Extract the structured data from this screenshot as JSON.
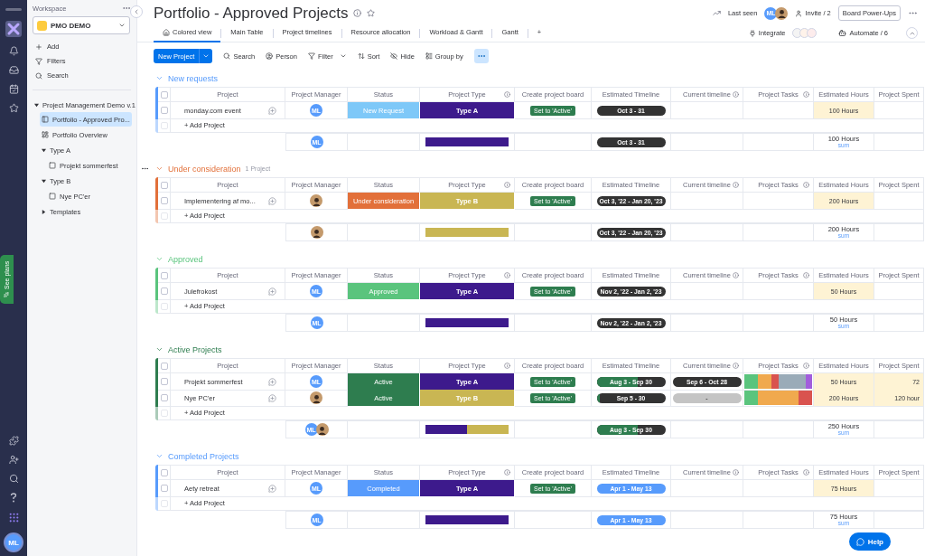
{
  "rail": {
    "see_plans": "See plans",
    "avatar": "ML"
  },
  "sidebar": {
    "workspace_label": "Workspace",
    "workspace": "PMO DEMO",
    "actions": [
      "Add",
      "Filters",
      "Search"
    ],
    "tree": [
      {
        "label": "Project Management Demo v.1",
        "kind": "folder",
        "expanded": true,
        "children": [
          {
            "label": "Portfolio - Approved Pro...",
            "kind": "board",
            "selected": true
          },
          {
            "label": "Portfolio Overview",
            "kind": "dashboard",
            "selected": false
          },
          {
            "label": "Type A",
            "kind": "folder",
            "expanded": true,
            "children": [
              {
                "label": "Projekt sommerfest",
                "kind": "board",
                "selected": false
              }
            ]
          },
          {
            "label": "Type B",
            "kind": "folder",
            "expanded": true,
            "children": [
              {
                "label": "Nye PC'er",
                "kind": "board",
                "selected": false
              }
            ]
          },
          {
            "label": "Templates",
            "kind": "folder",
            "expanded": false
          }
        ]
      }
    ]
  },
  "header": {
    "title": "Portfolio - Approved Projects",
    "last_seen": "Last seen",
    "last_seen_avatars": [
      {
        "kind": "initials",
        "initials": "ML"
      },
      {
        "kind": "photo"
      }
    ],
    "invite": "Invite / 2",
    "power_ups": "Board Power-Ups"
  },
  "tabs": [
    {
      "label": "Colored view",
      "selected": true
    },
    {
      "label": "Main Table",
      "selected": false
    },
    {
      "label": "Project timelines",
      "selected": false
    },
    {
      "label": "Resource allocation",
      "selected": false
    },
    {
      "label": "Workload & Gantt",
      "selected": false
    },
    {
      "label": "Gantt",
      "selected": false
    }
  ],
  "add_tab": "+",
  "integrate": "Integrate",
  "automate": "Automate / 6",
  "toolbar": {
    "primary": "New Project",
    "items": [
      "Search",
      "Person",
      "Filter",
      "Sort",
      "Hide",
      "Group by"
    ]
  },
  "groups": [
    {
      "title": "New requests",
      "color": "#579bfc",
      "all_checked": false,
      "add_checked": false,
      "columns": [
        {
          "label": "Project",
          "info": false
        },
        {
          "label": "Project Manager",
          "info": false
        },
        {
          "label": "Status",
          "info": false
        },
        {
          "label": "Project Type",
          "info": true
        },
        {
          "label": "Create project board",
          "info": false
        },
        {
          "label": "Estimated Timeline",
          "info": false
        },
        {
          "label": "Current timeline",
          "info": true
        },
        {
          "label": "Project Tasks",
          "info": true
        },
        {
          "label": "Estimated Hours",
          "info": false
        },
        {
          "label": "Project Spent",
          "info": false
        }
      ],
      "rows": [
        {
          "checked": false,
          "project": "monday.com event",
          "managers": [
            {
              "kind": "initials",
              "initials": "ML"
            }
          ],
          "status": {
            "label": "New Request",
            "color": "#7ec8f8"
          },
          "type": {
            "label": "Type A",
            "color": "#3d1a8c"
          },
          "board": "Set to 'Active'",
          "timeline": {
            "label": "Oct 3 - 31",
            "color": "#333333"
          },
          "hours": "100 Hours"
        }
      ],
      "add": "+ Add Project",
      "summary": {
        "managers": [
          {
            "kind": "initials",
            "initials": "ML"
          }
        ],
        "types": [
          {
            "color": "#3d1a8c"
          }
        ],
        "timeline": {
          "label": "Oct 3 - 31",
          "color": "#333333"
        },
        "hours": "100 Hours",
        "note": "sum"
      }
    },
    {
      "title": "Under consideration",
      "color": "#e2703a",
      "count": "1 Project",
      "all_checked": false,
      "add_checked": false,
      "columns": [
        {
          "label": "Project",
          "info": false
        },
        {
          "label": "Project Manager",
          "info": false
        },
        {
          "label": "Status",
          "info": false
        },
        {
          "label": "Project Type",
          "info": true
        },
        {
          "label": "Create project board",
          "info": false
        },
        {
          "label": "Estimated Timeline",
          "info": false
        },
        {
          "label": "Current timeline",
          "info": true
        },
        {
          "label": "Project Tasks",
          "info": true
        },
        {
          "label": "Estimated Hours",
          "info": false
        },
        {
          "label": "Project Spent",
          "info": false
        }
      ],
      "rows": [
        {
          "checked": false,
          "project": "Implementering af mo...",
          "managers": [
            {
              "kind": "photo"
            }
          ],
          "status": {
            "label": "Under consideration",
            "color": "#e2703a"
          },
          "type": {
            "label": "Type B",
            "color": "#c9b653"
          },
          "board": "Set to 'Active'",
          "timeline": {
            "label": "Oct 3, '22 - Jan 20, '23",
            "color": "#333333"
          },
          "hours": "200 Hours"
        }
      ],
      "add": "+ Add Project",
      "summary": {
        "managers": [
          {
            "kind": "photo"
          }
        ],
        "types": [
          {
            "color": "#c9b653"
          }
        ],
        "timeline": {
          "label": "Oct 3, '22 - Jan 20, '23",
          "color": "#333333"
        },
        "hours": "200 Hours",
        "note": "sum"
      }
    },
    {
      "title": "Approved",
      "color": "#5ac47d",
      "all_checked": false,
      "add_checked": false,
      "columns": [
        {
          "label": "Project",
          "info": false
        },
        {
          "label": "Project Manager",
          "info": false
        },
        {
          "label": "Status",
          "info": false
        },
        {
          "label": "Project Type",
          "info": true
        },
        {
          "label": "Create project board",
          "info": false
        },
        {
          "label": "Estimated Timeline",
          "info": false
        },
        {
          "label": "Current timeline",
          "info": true
        },
        {
          "label": "Project Tasks",
          "info": true
        },
        {
          "label": "Estimated Hours",
          "info": false
        },
        {
          "label": "Project Spent",
          "info": false
        }
      ],
      "rows": [
        {
          "checked": false,
          "project": "Julefrokost",
          "managers": [
            {
              "kind": "initials",
              "initials": "ML"
            }
          ],
          "status": {
            "label": "Approved",
            "color": "#5ac47d"
          },
          "type": {
            "label": "Type A",
            "color": "#3d1a8c"
          },
          "board": "Set to 'Active'",
          "timeline": {
            "label": "Nov 2, '22 - Jan 2, '23",
            "color": "#333333"
          },
          "hours": "50 Hours"
        }
      ],
      "add": "+ Add Project",
      "summary": {
        "managers": [
          {
            "kind": "initials",
            "initials": "ML"
          }
        ],
        "types": [
          {
            "color": "#3d1a8c"
          }
        ],
        "timeline": {
          "label": "Nov 2, '22 - Jan 2, '23",
          "color": "#333333"
        },
        "hours": "50 Hours",
        "note": "sum"
      }
    },
    {
      "title": "Active Projects",
      "color": "#2e7d4f",
      "all_checked": false,
      "add_checked": false,
      "columns": [
        {
          "label": "Project",
          "info": false
        },
        {
          "label": "Project Manager",
          "info": false
        },
        {
          "label": "Status",
          "info": false
        },
        {
          "label": "Project Type",
          "info": true
        },
        {
          "label": "Create project board",
          "info": false
        },
        {
          "label": "Estimated Timeline",
          "info": false
        },
        {
          "label": "Current timeline",
          "info": true
        },
        {
          "label": "Project Tasks",
          "info": true
        },
        {
          "label": "Estimated Hours",
          "info": false
        },
        {
          "label": "Project Spent",
          "info": false
        }
      ],
      "rows": [
        {
          "checked": false,
          "project": "Projekt sommerfest",
          "managers": [
            {
              "kind": "initials",
              "initials": "ML"
            }
          ],
          "status": {
            "label": "Active",
            "color": "#2e7d4f"
          },
          "type": {
            "label": "Type A",
            "color": "#3d1a8c"
          },
          "board": "Set to 'Active'",
          "timeline": {
            "label": "Aug 3 - Sep 30",
            "color": "#333333",
            "level": 0.6
          },
          "current": {
            "label": "Sep 6 - Oct 28",
            "color": "#333333"
          },
          "tasks": [
            {
              "color": "#5ac47d"
            },
            {
              "color": "#5ac47d"
            },
            {
              "color": "#f0a94e"
            },
            {
              "color": "#f0a94e"
            },
            {
              "color": "#d9534f"
            },
            {
              "color": "#9aabb8"
            },
            {
              "color": "#9aabb8"
            },
            {
              "color": "#9aabb8"
            },
            {
              "color": "#9aabb8"
            },
            {
              "color": "#a25ddc"
            }
          ],
          "hours": "50 Hours",
          "spent": "72"
        },
        {
          "checked": false,
          "project": "Nye PC'er",
          "managers": [
            {
              "kind": "photo"
            }
          ],
          "status": {
            "label": "Active",
            "color": "#2e7d4f"
          },
          "type": {
            "label": "Type B",
            "color": "#c9b653"
          },
          "board": "Set to 'Active'",
          "timeline": {
            "label": "Sep 5 - 30",
            "color": "#333333",
            "level": 0.05
          },
          "current": {
            "label": "-",
            "color": "#c4c4c4"
          },
          "tasks": [
            {
              "color": "#5ac47d"
            },
            {
              "color": "#5ac47d"
            },
            {
              "color": "#f0a94e"
            },
            {
              "color": "#f0a94e"
            },
            {
              "color": "#f0a94e"
            },
            {
              "color": "#f0a94e"
            },
            {
              "color": "#f0a94e"
            },
            {
              "color": "#f0a94e"
            },
            {
              "color": "#d9534f"
            },
            {
              "color": "#d9534f"
            }
          ],
          "hours": "200 Hours",
          "spent": "120 hour"
        }
      ],
      "add": "+ Add Project",
      "summary": {
        "managers": [
          {
            "kind": "initials",
            "initials": "ML"
          },
          {
            "kind": "photo"
          }
        ],
        "types": [
          {
            "color": "#3d1a8c"
          },
          {
            "color": "#c9b653"
          }
        ],
        "timeline": {
          "label": "Aug 3 - Sep 30",
          "color": "#333333",
          "level": 0.6
        },
        "hours": "250 Hours",
        "note": "sum"
      }
    },
    {
      "title": "Completed Projects",
      "color": "#579bfc",
      "all_checked": false,
      "add_checked": false,
      "columns": [
        {
          "label": "Project",
          "info": false
        },
        {
          "label": "Project Manager",
          "info": false
        },
        {
          "label": "Status",
          "info": false
        },
        {
          "label": "Project Type",
          "info": true
        },
        {
          "label": "Create project board",
          "info": false
        },
        {
          "label": "Estimated Timeline",
          "info": false
        },
        {
          "label": "Current timeline",
          "info": true
        },
        {
          "label": "Project Tasks",
          "info": true
        },
        {
          "label": "Estimated Hours",
          "info": false
        },
        {
          "label": "Project Spent",
          "info": false
        }
      ],
      "rows": [
        {
          "checked": false,
          "project": "Aety retreat",
          "managers": [
            {
              "kind": "initials",
              "initials": "ML"
            }
          ],
          "status": {
            "label": "Completed",
            "color": "#579bfc"
          },
          "type": {
            "label": "Type A",
            "color": "#3d1a8c"
          },
          "board": "Set to 'Active'",
          "timeline": {
            "label": "Apr 1 - May 13",
            "color": "#579bfc"
          },
          "hours": "75 Hours"
        }
      ],
      "add": "+ Add Project",
      "summary": {
        "managers": [
          {
            "kind": "initials",
            "initials": "ML"
          }
        ],
        "types": [
          {
            "color": "#3d1a8c"
          }
        ],
        "timeline": {
          "label": "Apr 1 - May 13",
          "color": "#579bfc"
        },
        "hours": "75 Hours",
        "note": "sum"
      }
    }
  ],
  "help": "Help"
}
